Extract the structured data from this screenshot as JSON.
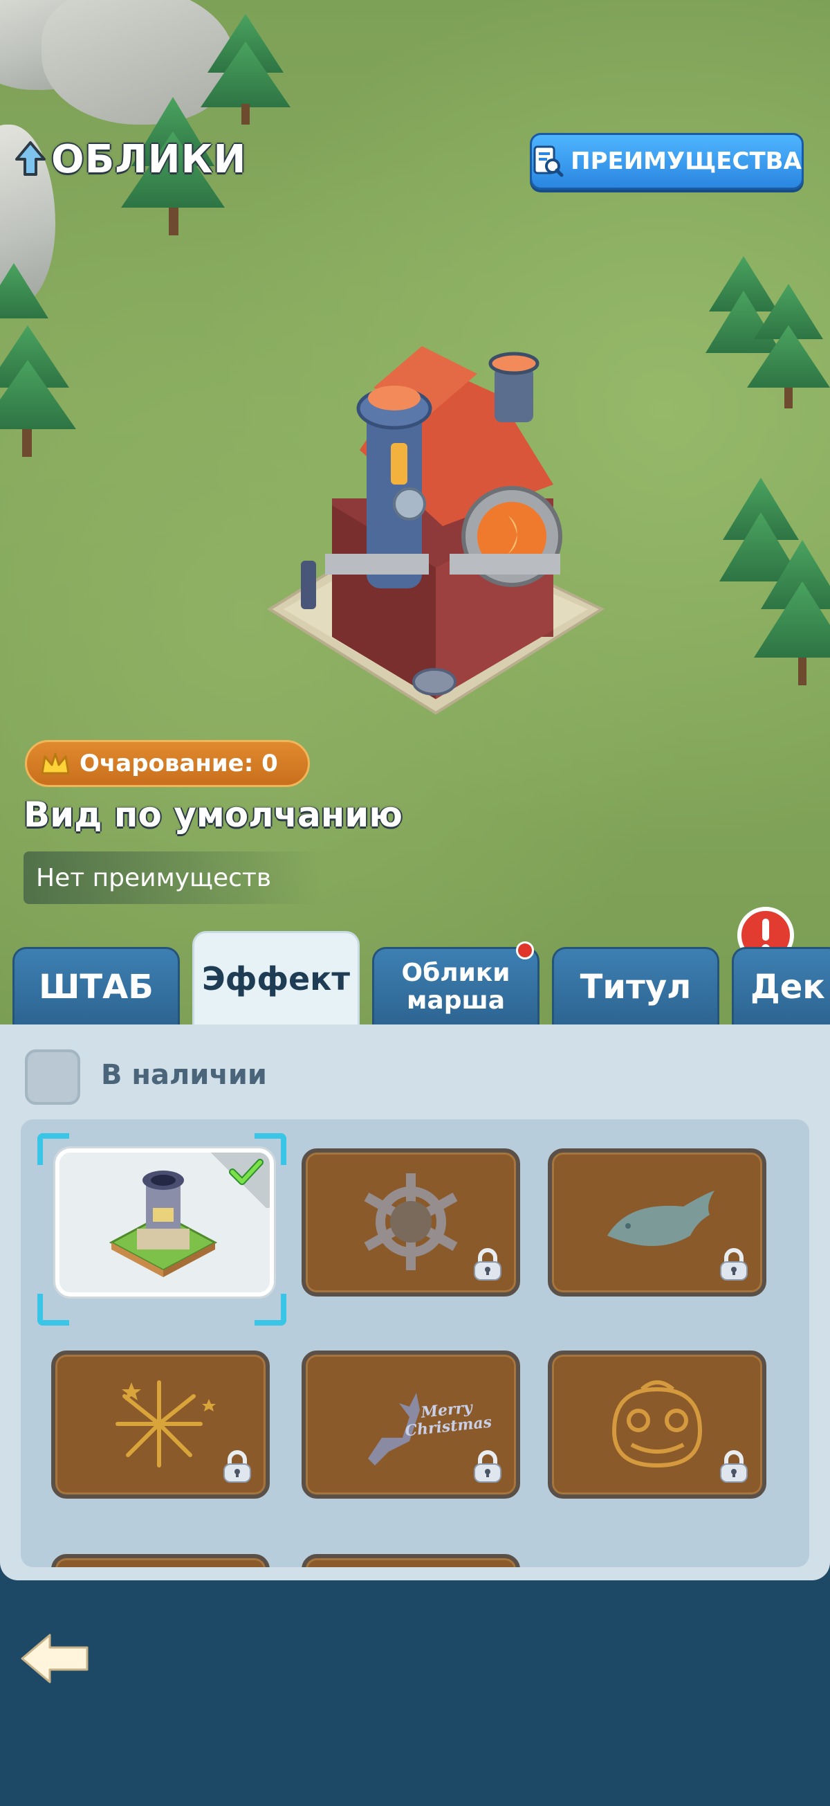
{
  "header": {
    "title": "ОБЛИКИ",
    "benefits_button": "ПРЕИМУЩЕСТВА"
  },
  "skin_info": {
    "charm_label": "Очарование: 0",
    "name": "Вид по умолчанию",
    "benefits": "Нет преимуществ"
  },
  "tabs": [
    {
      "label": "ШТАБ",
      "active": false,
      "badge": false
    },
    {
      "label": "Эффект",
      "active": true,
      "badge": false
    },
    {
      "label": "Облики\nмарша",
      "active": false,
      "badge": true
    },
    {
      "label": "Титул",
      "active": false,
      "badge": false
    },
    {
      "label": "Дек",
      "active": false,
      "badge": false
    }
  ],
  "filter": {
    "label": "В наличии",
    "checked": false
  },
  "items": [
    {
      "name": "default-tower",
      "state": "owned-selected"
    },
    {
      "name": "snowflake",
      "state": "locked"
    },
    {
      "name": "whale",
      "state": "locked"
    },
    {
      "name": "fireworks",
      "state": "locked"
    },
    {
      "name": "merry-christmas",
      "state": "locked",
      "text": "Merry Christmas"
    },
    {
      "name": "lion-dance",
      "state": "locked"
    }
  ],
  "colors": {
    "accent_blue": "#2a86e0",
    "tab_blue": "#3d7fb2",
    "panel_bg": "#d1dfe8",
    "locked_card": "#8a5a2b",
    "bottom_bar": "#1d4866"
  }
}
